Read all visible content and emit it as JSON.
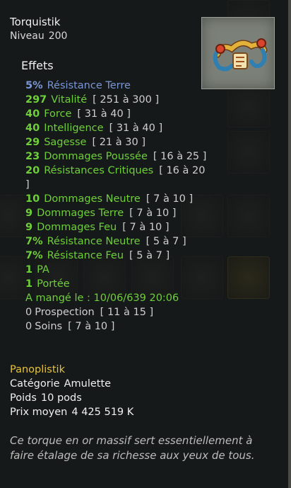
{
  "item": {
    "name": "Torquistik",
    "level_label": "Niveau",
    "level_value": "200"
  },
  "effects_title": "Effets",
  "effects": [
    {
      "num": "5%",
      "label": "Résistance Terre",
      "range": "",
      "color": "#7a96d6"
    },
    {
      "num": "297",
      "label": "Vitalité",
      "range": "[ 251 à 300 ]",
      "color": "#6fcf3a"
    },
    {
      "num": "40",
      "label": "Force",
      "range": "[ 31 à 40 ]",
      "color": "#6fcf3a"
    },
    {
      "num": "40",
      "label": "Intelligence",
      "range": "[ 31 à 40 ]",
      "color": "#6fcf3a"
    },
    {
      "num": "29",
      "label": "Sagesse",
      "range": "[ 21 à 30 ]",
      "color": "#6fcf3a"
    },
    {
      "num": "23",
      "label": "Dommages Poussée",
      "range": "[ 16 à 25 ]",
      "color": "#6fcf3a"
    },
    {
      "num": "20",
      "label": "Résistances Critiques",
      "range": "[ 16 à 20 ]",
      "color": "#6fcf3a"
    },
    {
      "num": "10",
      "label": "Dommages Neutre",
      "range": "[ 7 à 10 ]",
      "color": "#6fcf3a"
    },
    {
      "num": "9",
      "label": "Dommages Terre",
      "range": "[ 7 à 10 ]",
      "color": "#6fcf3a"
    },
    {
      "num": "9",
      "label": "Dommages Feu",
      "range": "[ 7 à 10 ]",
      "color": "#6fcf3a"
    },
    {
      "num": "7%",
      "label": "Résistance Neutre",
      "range": "[ 5 à 7 ]",
      "color": "#6fcf3a"
    },
    {
      "num": "7%",
      "label": "Résistance Feu",
      "range": "[ 5 à 7 ]",
      "color": "#6fcf3a"
    },
    {
      "num": "1",
      "label": "PA",
      "range": "",
      "color": "#6fcf3a"
    },
    {
      "num": "1",
      "label": "Portée",
      "range": "",
      "color": "#6fcf3a"
    },
    {
      "num": "",
      "label": "A mangé le : 10/06/639 20:06",
      "range": "",
      "color": "#6fcf3a"
    },
    {
      "num": "0",
      "label": "Prospection",
      "range": "[ 11 à 15 ]",
      "color": "#cfcfcf"
    },
    {
      "num": "0",
      "label": "Soins",
      "range": "[ 7 à 10 ]",
      "color": "#cfcfcf"
    }
  ],
  "meta": {
    "panoplie": "Panoplistik",
    "category_label": "Catégorie",
    "category_value": "Amulette",
    "weight_label": "Poids",
    "weight_value": "10 pods",
    "price_label": "Prix moyen",
    "price_value": "4 425 519 K"
  },
  "description": "Ce torque en or massif sert essentiellement à faire étalage de sa richesse aux yeux de tous.",
  "colors": {
    "panoplie": "#e6c23a",
    "effect_green": "#6fcf3a",
    "effect_blue": "#7a96d6",
    "effect_grey": "#cfcfcf"
  }
}
